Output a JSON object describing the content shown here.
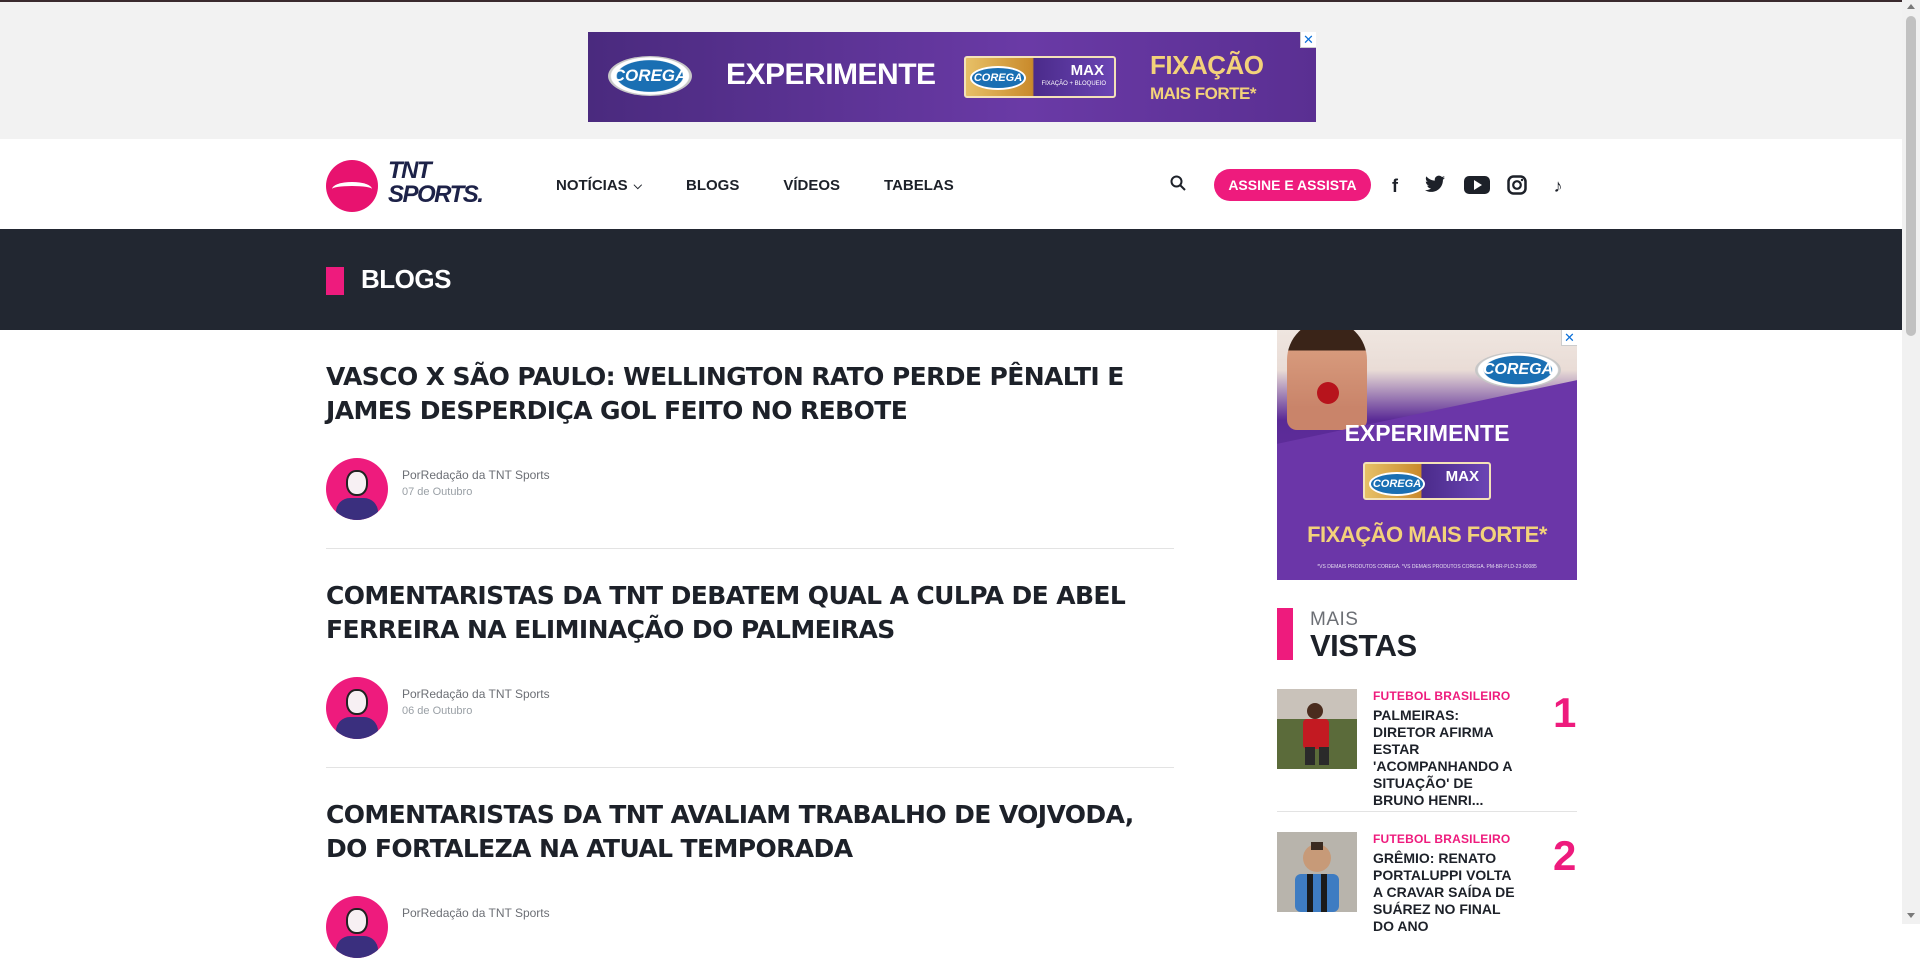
{
  "top_ad": {
    "brand": "COREGA",
    "headline": "EXPERIMENTE",
    "product_name": "MAX",
    "product_sub": "FIXAÇÃO + BLOQUEIO",
    "tagline_1": "FIXAÇÃO",
    "tagline_2": "MAIS FORTE*",
    "close_icon": "close-icon"
  },
  "header": {
    "logo_line1": "TNT",
    "logo_line2": "SPORTS.",
    "nav": [
      {
        "label": "NOTÍCIAS",
        "has_dropdown": true
      },
      {
        "label": "BLOGS"
      },
      {
        "label": "VÍDEOS"
      },
      {
        "label": "TABELAS"
      }
    ],
    "cta": "ASSINE E ASSISTA",
    "social_icons": [
      "facebook-icon",
      "twitter-icon",
      "youtube-icon",
      "instagram-icon",
      "tiktok-icon"
    ],
    "social_glyphs": [
      "f",
      "🐦",
      "▶",
      "◎",
      "♪"
    ]
  },
  "section": {
    "title": "BLOGS"
  },
  "articles": [
    {
      "title": "VASCO X SÃO PAULO: WELLINGTON RATO PERDE PÊNALTI E JAMES DESPERDIÇA GOL FEITO NO REBOTE",
      "byline": "PorRedação da TNT Sports",
      "date": "07 de Outubro"
    },
    {
      "title": "COMENTARISTAS DA TNT DEBATEM QUAL A CULPA DE ABEL FERREIRA NA ELIMINAÇÃO DO PALMEIRAS",
      "byline": "PorRedação da TNT Sports",
      "date": "06 de Outubro"
    },
    {
      "title": "COMENTARISTAS DA TNT AVALIAM TRABALHO DE VOJVODA, DO FORTALEZA NA ATUAL TEMPORADA",
      "byline": "PorRedação da TNT Sports",
      "date": ""
    }
  ],
  "side_ad": {
    "brand": "COREGA",
    "headline": "EXPERIMENTE",
    "product_name": "MAX",
    "tagline": "FIXAÇÃO MAIS FORTE*",
    "fine_print": "*VS DEMAIS PRODUTOS COREGA. *VS DEMAIS PRODUTOS COREGA. PM-BR-PLD-23-00085"
  },
  "mais_vistas": {
    "small": "MAIS",
    "big": "VISTAS",
    "items": [
      {
        "rank": "1",
        "category": "FUTEBOL BRASILEIRO",
        "title": "PALMEIRAS: DIRETOR AFIRMA ESTAR 'ACOMPANHANDO A SITUAÇÃO' DE BRUNO HENRI..."
      },
      {
        "rank": "2",
        "category": "FUTEBOL BRASILEIRO",
        "title": "GRÊMIO: RENATO PORTALUPPI VOLTA A CRAVAR SAÍDA DE SUÁREZ NO FINAL DO ANO"
      }
    ]
  },
  "colors": {
    "accent": "#ee1b7d",
    "dark_bar": "#222731",
    "text": "#1d2129"
  }
}
